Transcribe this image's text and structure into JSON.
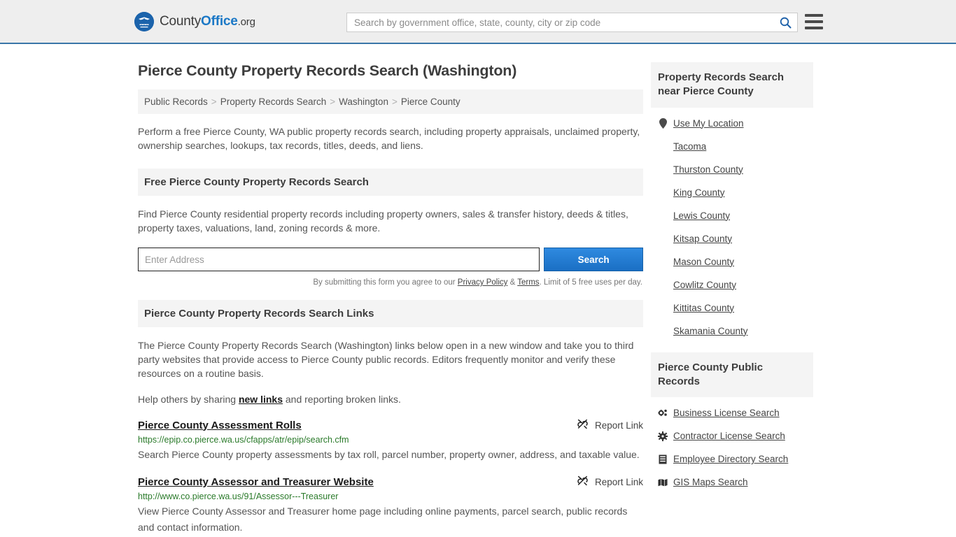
{
  "header": {
    "logo": {
      "icon": "eagle-shield-icon",
      "part1": "County",
      "part2": "Office",
      "part3": ".org"
    },
    "search": {
      "placeholder": "Search by government office, state, county, city or zip code",
      "value": "",
      "button_icon": "search-icon"
    },
    "menu_icon": "hamburger-menu-icon",
    "accent_color": "#3a76a8"
  },
  "main": {
    "page_title": "Pierce County Property Records Search (Washington)",
    "breadcrumb": [
      {
        "label": "Public Records"
      },
      {
        "label": "Property Records Search"
      },
      {
        "label": "Washington"
      },
      {
        "label": "Pierce County"
      }
    ],
    "breadcrumb_separator": ">",
    "intro": "Perform a free Pierce County, WA public property records search, including property appraisals, unclaimed property, ownership searches, lookups, tax records, titles, deeds, and liens.",
    "free_search": {
      "heading": "Free Pierce County Property Records Search",
      "description": "Find Pierce County residential property records including property owners, sales & transfer history, deeds & titles, property taxes, valuations, land, zoning records & more.",
      "input_placeholder": "Enter Address",
      "input_value": "",
      "button_label": "Search",
      "note_prefix": "By submitting this form you agree to our ",
      "note_privacy": "Privacy Policy",
      "note_amp": " & ",
      "note_terms": "Terms",
      "note_suffix": ". Limit of 5 free uses per day."
    },
    "links_section": {
      "heading": "Pierce County Property Records Search Links",
      "paragraph": "The Pierce County Property Records Search (Washington) links below open in a new window and take you to third party websites that provide access to Pierce County public records. Editors frequently monitor and verify these resources on a routine basis.",
      "help_prefix": "Help others by sharing ",
      "help_link": "new links",
      "help_suffix": " and reporting broken links.",
      "report_label": "Report Link",
      "report_icon": "broken-link-icon",
      "entries": [
        {
          "title": "Pierce County Assessment Rolls",
          "url": "https://epip.co.pierce.wa.us/cfapps/atr/epip/search.cfm",
          "description": "Search Pierce County property assessments by tax roll, parcel number, property owner, address, and taxable value."
        },
        {
          "title": "Pierce County Assessor and Treasurer Website",
          "url": "http://www.co.pierce.wa.us/91/Assessor---Treasurer",
          "description": "View Pierce County Assessor and Treasurer home page including online payments, parcel search, public records and contact information."
        }
      ]
    }
  },
  "sidebar": {
    "nearby": {
      "heading": "Property Records Search near Pierce County",
      "items": [
        {
          "label": "Use My Location",
          "icon": "map-pin-icon"
        },
        {
          "label": "Tacoma",
          "icon": ""
        },
        {
          "label": "Thurston County",
          "icon": ""
        },
        {
          "label": "King County",
          "icon": ""
        },
        {
          "label": "Lewis County",
          "icon": ""
        },
        {
          "label": "Kitsap County",
          "icon": ""
        },
        {
          "label": "Mason County",
          "icon": ""
        },
        {
          "label": "Cowlitz County",
          "icon": ""
        },
        {
          "label": "Kittitas County",
          "icon": ""
        },
        {
          "label": "Skamania County",
          "icon": ""
        }
      ]
    },
    "public_records": {
      "heading": "Pierce County Public Records",
      "items": [
        {
          "label": "Business License Search",
          "icon": "cogs-icon"
        },
        {
          "label": "Contractor License Search",
          "icon": "gear-icon"
        },
        {
          "label": "Employee Directory Search",
          "icon": "list-icon"
        },
        {
          "label": "GIS Maps Search",
          "icon": "map-icon"
        }
      ]
    }
  }
}
